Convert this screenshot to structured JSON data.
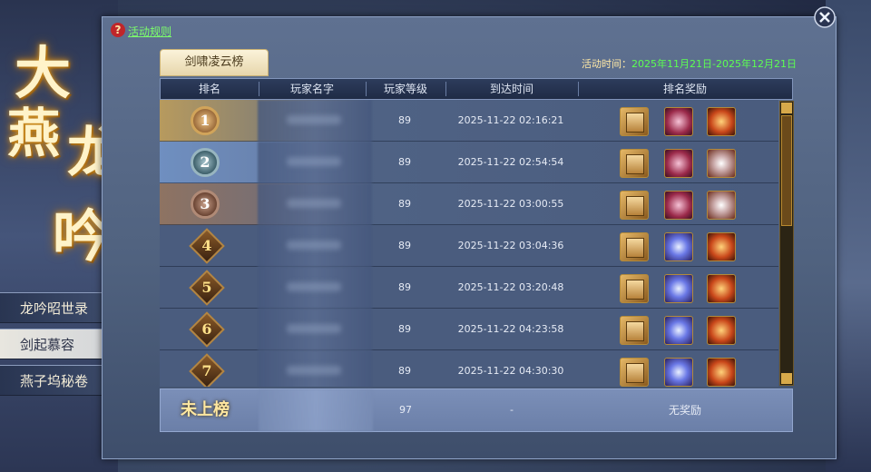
{
  "help_link": "活动规则",
  "side_menu": [
    {
      "label": "龙吟昭世录",
      "active": false
    },
    {
      "label": "剑起慕容",
      "active": true
    },
    {
      "label": "燕子坞秘卷",
      "active": false
    }
  ],
  "logo_text": [
    "大",
    "燕",
    "龙",
    "吟"
  ],
  "tab": "剑啸凌云榜",
  "time": {
    "label": "活动时间：",
    "value": "2025年11月21日-2025年12月21日"
  },
  "columns": [
    "排名",
    "玩家名字",
    "玩家等级",
    "到达时间",
    "排名奖励"
  ],
  "rows": [
    {
      "rank": "1",
      "level": "89",
      "time": "2025-11-22  02:16:21"
    },
    {
      "rank": "2",
      "level": "89",
      "time": "2025-11-22  02:54:54"
    },
    {
      "rank": "3",
      "level": "89",
      "time": "2025-11-22  03:00:55"
    },
    {
      "rank": "4",
      "level": "89",
      "time": "2025-11-22  03:04:36"
    },
    {
      "rank": "5",
      "level": "89",
      "time": "2025-11-22  03:20:48"
    },
    {
      "rank": "6",
      "level": "89",
      "time": "2025-11-22  04:23:58"
    },
    {
      "rank": "7",
      "level": "89",
      "time": "2025-11-22  04:30:30"
    }
  ],
  "reward_icons": [
    "bound-scroll-icon",
    "pink-gem-icon",
    "crystal-wing-icon",
    "orange-chest-icon",
    "white-pack-icon"
  ],
  "self_row": {
    "rank": "未上榜",
    "level": "97",
    "time": "-",
    "reward": "无奖励"
  },
  "colors": {
    "accent_gold": "#d1a45a",
    "time_green": "#5dff52",
    "help_green": "#7cff6b"
  }
}
